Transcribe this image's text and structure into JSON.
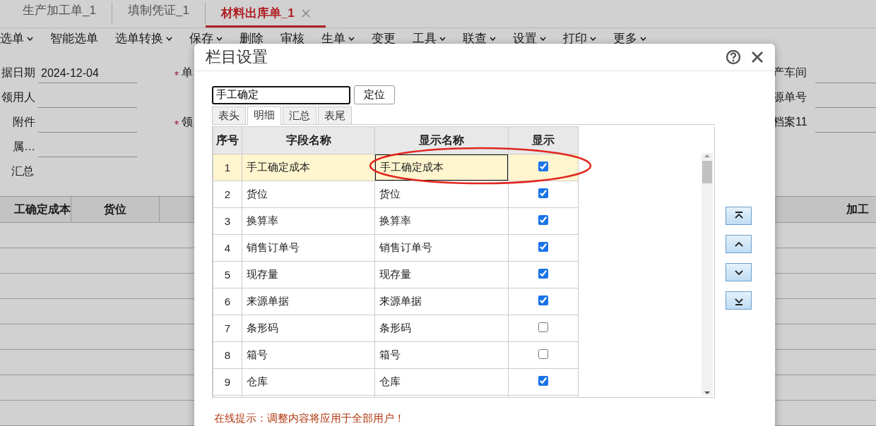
{
  "doc_tabs": [
    {
      "label": "生产加工单_1",
      "selected": false
    },
    {
      "label": "填制凭证_1",
      "selected": false
    },
    {
      "label": "材料出库单_1",
      "selected": true
    }
  ],
  "toolbar": [
    {
      "label": "选单",
      "dropdown": true
    },
    {
      "label": "智能选单",
      "dropdown": false
    },
    {
      "label": "选单转换",
      "dropdown": true
    },
    {
      "label": "保存",
      "dropdown": true
    },
    {
      "label": "删除",
      "dropdown": false
    },
    {
      "label": "审核",
      "dropdown": false
    },
    {
      "label": "生单",
      "dropdown": true
    },
    {
      "label": "变更",
      "dropdown": false
    },
    {
      "label": "工具",
      "dropdown": true
    },
    {
      "label": "联查",
      "dropdown": true
    },
    {
      "label": "设置",
      "dropdown": true
    },
    {
      "label": "打印",
      "dropdown": true
    },
    {
      "label": "更多",
      "dropdown": true
    }
  ],
  "form": {
    "left": [
      {
        "label": "据日期",
        "value": "2024-12-04"
      },
      {
        "label": "领用人"
      },
      {
        "label": "附件"
      },
      {
        "label": "属…"
      },
      {
        "label": "汇总",
        "kind": "plain"
      }
    ],
    "middle": [
      {
        "label": "单",
        "required": true
      },
      {
        "label": "领",
        "required": true
      }
    ],
    "right": [
      {
        "label": "产车间"
      },
      {
        "label": "源单号"
      },
      {
        "label": "档案11"
      }
    ]
  },
  "grid": {
    "columns": [
      "工确定成本",
      "货位",
      "加工"
    ]
  },
  "dialog": {
    "title": "栏目设置",
    "search": {
      "value": "手工确定"
    },
    "locate_button": "定位",
    "tabs": [
      {
        "label": "表头",
        "selected": false
      },
      {
        "label": "明细",
        "selected": true
      },
      {
        "label": "汇总",
        "selected": false
      },
      {
        "label": "表尾",
        "selected": false
      }
    ],
    "table": {
      "columns": [
        "序号",
        "字段名称",
        "显示名称",
        "显示"
      ],
      "rows": [
        {
          "index": "1",
          "field": "手工确定成本",
          "display": "手工确定成本",
          "show": true,
          "selected": true,
          "editing": true
        },
        {
          "index": "2",
          "field": "货位",
          "display": "货位",
          "show": true,
          "selected": false,
          "editing": false
        },
        {
          "index": "3",
          "field": "换算率",
          "display": "换算率",
          "show": true,
          "selected": false,
          "editing": false
        },
        {
          "index": "4",
          "field": "销售订单号",
          "display": "销售订单号",
          "show": true,
          "selected": false,
          "editing": false
        },
        {
          "index": "5",
          "field": "现存量",
          "display": "现存量",
          "show": true,
          "selected": false,
          "editing": false
        },
        {
          "index": "6",
          "field": "来源单据",
          "display": "来源单据",
          "show": true,
          "selected": false,
          "editing": false
        },
        {
          "index": "7",
          "field": "条形码",
          "display": "条形码",
          "show": false,
          "selected": false,
          "editing": false
        },
        {
          "index": "8",
          "field": "箱号",
          "display": "箱号",
          "show": false,
          "selected": false,
          "editing": false
        },
        {
          "index": "9",
          "field": "仓库",
          "display": "仓库",
          "show": true,
          "selected": false,
          "editing": false
        }
      ]
    },
    "tip": "在线提示：调整内容将应用于全部用户！"
  }
}
